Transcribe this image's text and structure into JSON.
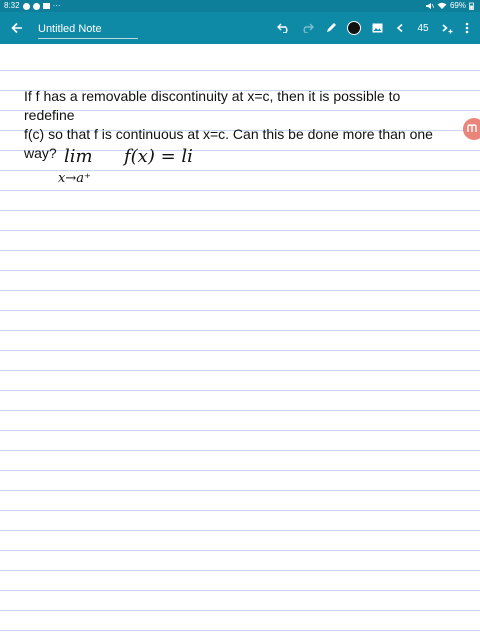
{
  "status": {
    "time": "8:32",
    "dots": "···",
    "battery": "69%"
  },
  "toolbar": {
    "title_placeholder": "Untitled Note",
    "page_number": "45",
    "current_color": "#111111",
    "accent_color": "#0f8aa6"
  },
  "note": {
    "question_line1": "If f has a removable discontinuity at x=c, then it is possible to redefine",
    "question_line2": "f(c) so that f is continuous at x=c. Can this be done more than one way?"
  },
  "handwriting": {
    "lim": "lim",
    "subscript": "x→a⁺",
    "expr": "f(x) = li"
  }
}
